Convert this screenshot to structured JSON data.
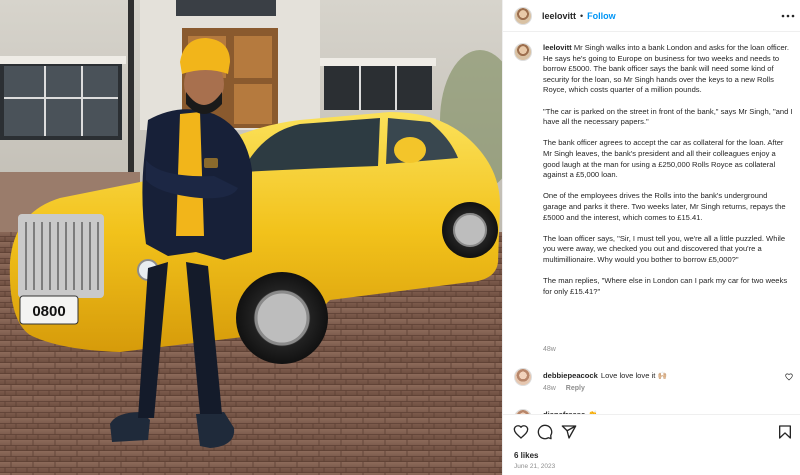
{
  "post": {
    "username": "leelovitt",
    "dot": "•",
    "follow_label": "Follow",
    "more_icon": "more-horizontal-icon"
  },
  "caption": {
    "username": "leelovitt",
    "p1": "Mr Singh walks into a bank London and asks for the loan officer. He says he's going to Europe on business for two weeks and needs to borrow £5000. The bank officer says the bank will need some kind of security for the loan, so Mr Singh hands over the keys to a new Rolls Royce, which costs quarter of a million pounds.",
    "p2": "\"The car is parked on the street in front of the bank,\" says Mr Singh, \"and I have all the necessary papers.\"",
    "p3": "The bank officer agrees to accept the car as collateral for the loan. After Mr Singh leaves, the bank's president and all their colleagues enjoy a good laugh at the man for using a £250,000 Rolls Royce as collateral against a £5,000 loan.",
    "p4": "One of the employees drives the Rolls into the bank's underground garage and parks it there. Two weeks later, Mr Singh returns, repays the £5000 and the interest, which comes to £15.41.",
    "p5": "The loan officer says, \"Sir, I must tell you, we're all a little puzzled. While you were away, we checked you out and discovered that you're a multimillionaire. Why would you bother to borrow £5,000?\"",
    "p6": "The man replies, \"Where else in London can I park my car for two weeks for only £15.41?\"",
    "time": "48w"
  },
  "comments": [
    {
      "username": "debbiepeacock",
      "text": "Love love love it 🙌🏼",
      "time": "48w",
      "reply_label": "Reply"
    },
    {
      "username": "dianefreese",
      "text": "👏"
    }
  ],
  "actions": {
    "icons": [
      "heart-icon",
      "comment-icon",
      "share-icon",
      "bookmark-icon"
    ],
    "likes": "6 likes",
    "date": "June 21, 2023"
  },
  "photo": {
    "license_plate": "0800",
    "car_color": "#f2c21b",
    "turban_color": "#f2b51a"
  }
}
